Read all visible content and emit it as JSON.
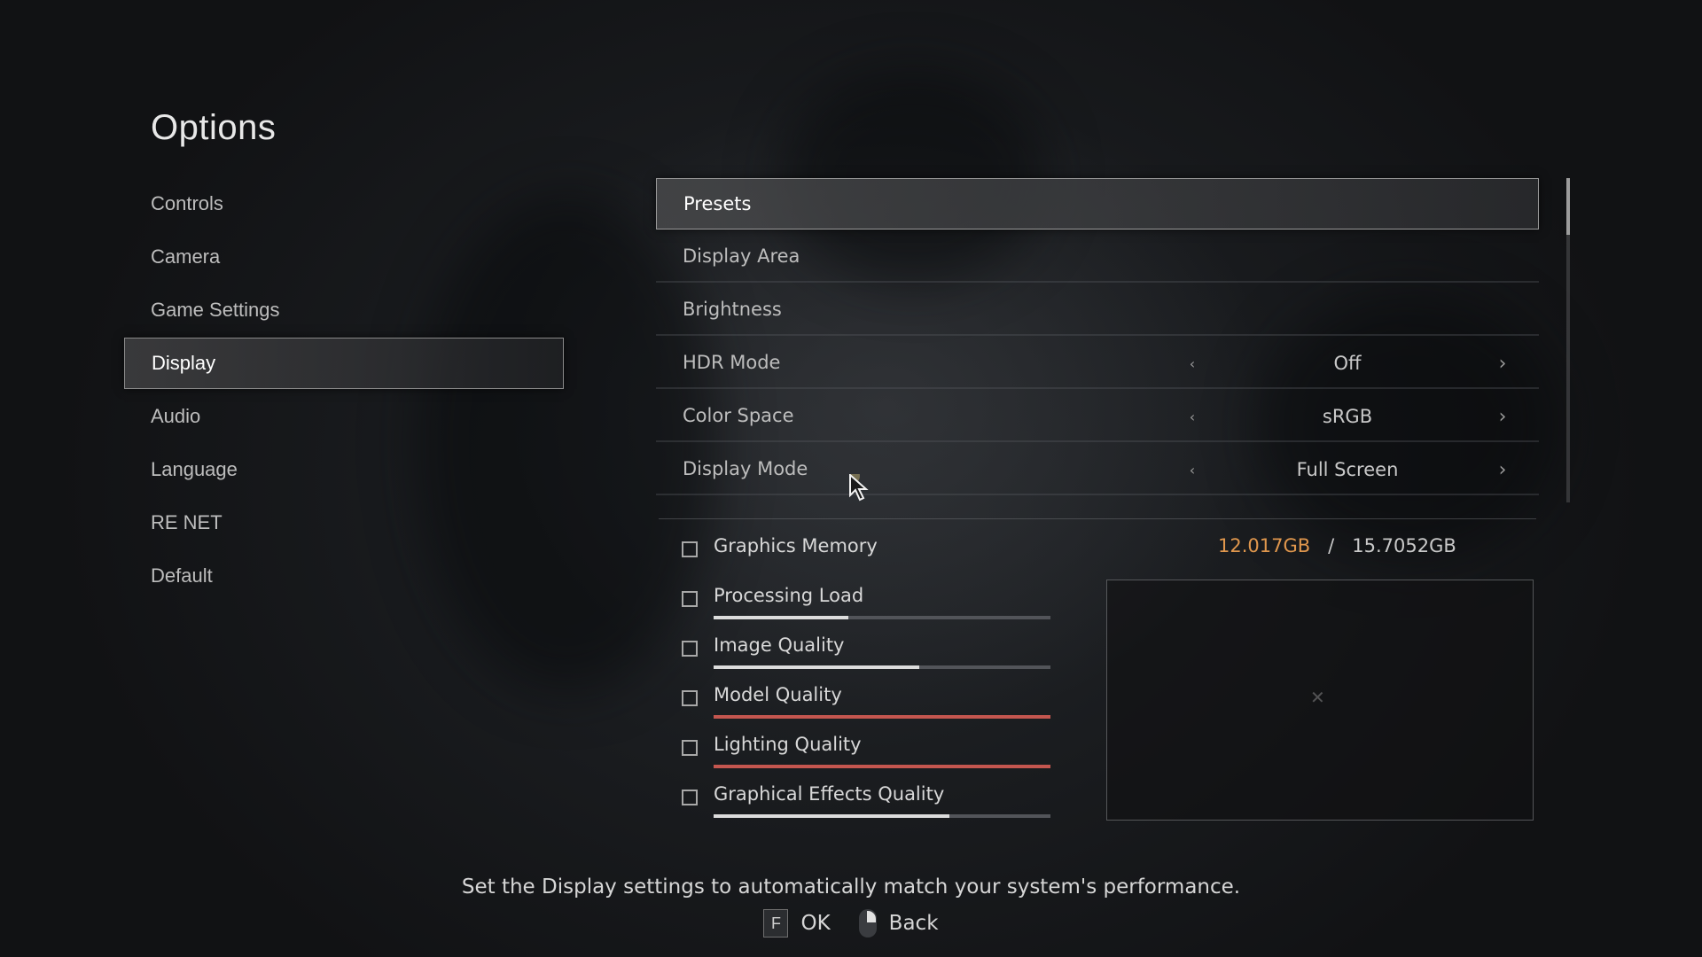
{
  "title": "Options",
  "sidebar": {
    "items": [
      {
        "label": "Controls",
        "active": false
      },
      {
        "label": "Camera",
        "active": false
      },
      {
        "label": "Game Settings",
        "active": false
      },
      {
        "label": "Display",
        "active": true
      },
      {
        "label": "Audio",
        "active": false
      },
      {
        "label": "Language",
        "active": false
      },
      {
        "label": "RE NET",
        "active": false
      },
      {
        "label": "Default",
        "active": false
      }
    ]
  },
  "settings": {
    "presets": "Presets",
    "display_area": "Display Area",
    "brightness": "Brightness",
    "hdr_mode": {
      "label": "HDR Mode",
      "value": "Off"
    },
    "color_space": {
      "label": "Color Space",
      "value": "sRGB"
    },
    "display_mode": {
      "label": "Display Mode",
      "value": "Full Screen"
    }
  },
  "performance": {
    "graphics_memory": {
      "label": "Graphics Memory",
      "used": "12.017GB",
      "separator": "/",
      "total": "15.7052GB"
    },
    "meters": [
      {
        "label": "Processing Load",
        "level": 0.4,
        "color": "#dcdcdc"
      },
      {
        "label": "Image Quality",
        "level": 0.61,
        "color": "#dcdcdc"
      },
      {
        "label": "Model Quality",
        "level": 1.0,
        "color": "#c4564f"
      },
      {
        "label": "Lighting Quality",
        "level": 1.0,
        "color": "#c4564f"
      },
      {
        "label": "Graphical Effects Quality",
        "level": 0.7,
        "color": "#dcdcdc"
      }
    ]
  },
  "footer": {
    "description": "Set the Display settings to automatically match your system's performance.",
    "ok_key": "F",
    "ok_label": "OK",
    "back_label": "Back"
  },
  "colors": {
    "memory_used": "#e0974d",
    "meter_warning": "#c4564f"
  }
}
